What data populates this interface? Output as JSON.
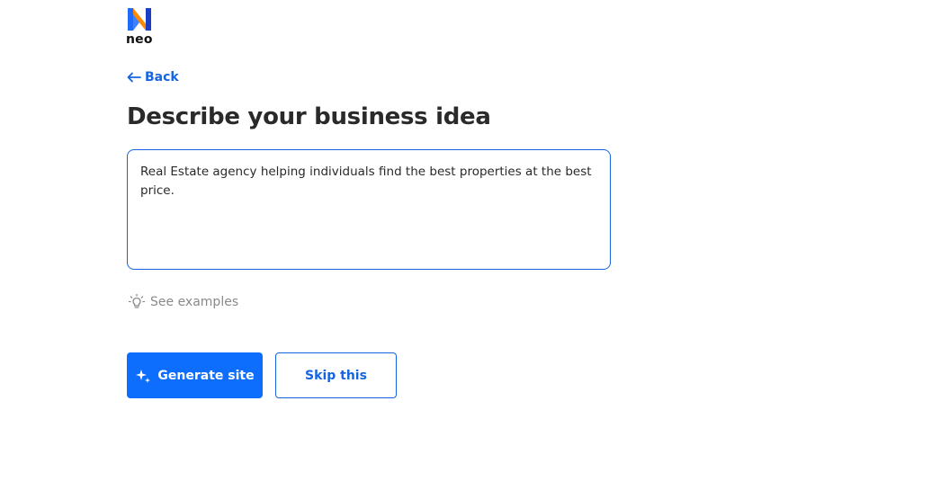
{
  "brand": {
    "logo_text": "neo",
    "logo_colors": [
      "#ff8a00",
      "#1f6bff",
      "#1a3fc4"
    ]
  },
  "nav": {
    "back_label": "Back",
    "back_icon": "arrow-left-icon"
  },
  "main": {
    "title": "Describe your business idea",
    "idea_value": "Real Estate agency helping individuals find the best properties at the best price.",
    "examples_label": "See examples",
    "examples_icon": "lightbulb-icon"
  },
  "actions": {
    "generate_label": "Generate site",
    "generate_icon": "sparkle-icon",
    "skip_label": "Skip this"
  },
  "colors": {
    "accent": "#0d6efd",
    "link": "#1565e0",
    "title": "#2a2a2a",
    "muted": "#8a8a8a"
  }
}
